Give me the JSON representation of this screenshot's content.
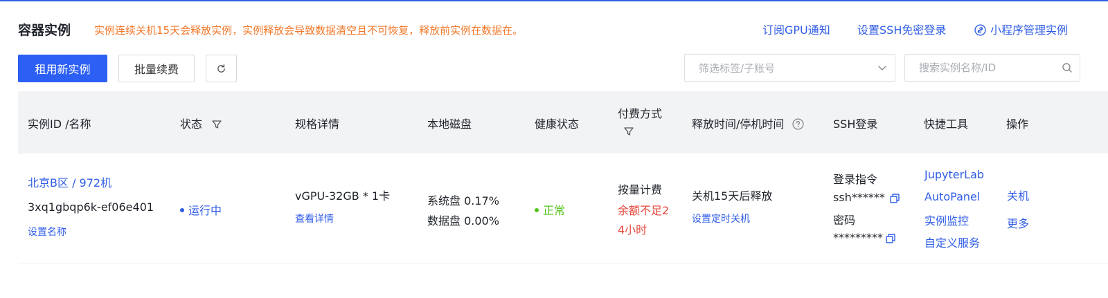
{
  "header": {
    "title": "容器实例",
    "warning": "实例连续关机15天会释放实例，实例释放会导致数据清空且不可恢复，释放前实例在数据在。",
    "links": {
      "gpu_notify": "订阅GPU通知",
      "ssh_free_login": "设置SSH免密登录",
      "mini_program": "小程序管理实例"
    }
  },
  "toolbar": {
    "rent_new": "租用新实例",
    "batch_renew": "批量续费",
    "filter_placeholder": "筛选标签/子账号",
    "search_placeholder": "搜索实例名称/ID"
  },
  "table": {
    "headers": {
      "instance": "实例ID /名称",
      "status": "状态",
      "spec": "规格详情",
      "disk": "本地磁盘",
      "health": "健康状态",
      "billing": "付费方式",
      "release": "释放时间/停机时间",
      "ssh": "SSH登录",
      "tools": "快捷工具",
      "actions": "操作"
    },
    "row": {
      "region": "北京B区 / 972机",
      "id": "3xq1gbqp6k-ef06e401",
      "set_name": "设置名称",
      "status": "运行中",
      "spec": "vGPU-32GB * 1卡",
      "view_detail": "查看详情",
      "sys_disk": "系统盘 0.17%",
      "data_disk": "数据盘 0.00%",
      "health": "正常",
      "billing": "按量计费",
      "balance_warn_1": "余额不足2",
      "balance_warn_2": "4小时",
      "release": "关机15天后释放",
      "scheduled_shutdown": "设置定时关机",
      "login_cmd_label": "登录指令",
      "login_cmd": "ssh******",
      "password_label": "密码",
      "password": "*********",
      "tools": [
        "JupyterLab",
        "AutoPanel",
        "实例监控",
        "自定义服务"
      ],
      "actions": [
        "关机",
        "更多"
      ]
    }
  },
  "colors": {
    "accent": "#2f5de6",
    "primary_button": "#2c5ff3",
    "warning": "#f2792b",
    "danger": "#e5463a",
    "success": "#52c41a",
    "header_bg": "#f2f3f5"
  },
  "icons": [
    "refresh-icon",
    "chevron-down-icon",
    "search-icon",
    "link-icon",
    "filter-icon",
    "help-circle-icon",
    "copy-icon"
  ]
}
